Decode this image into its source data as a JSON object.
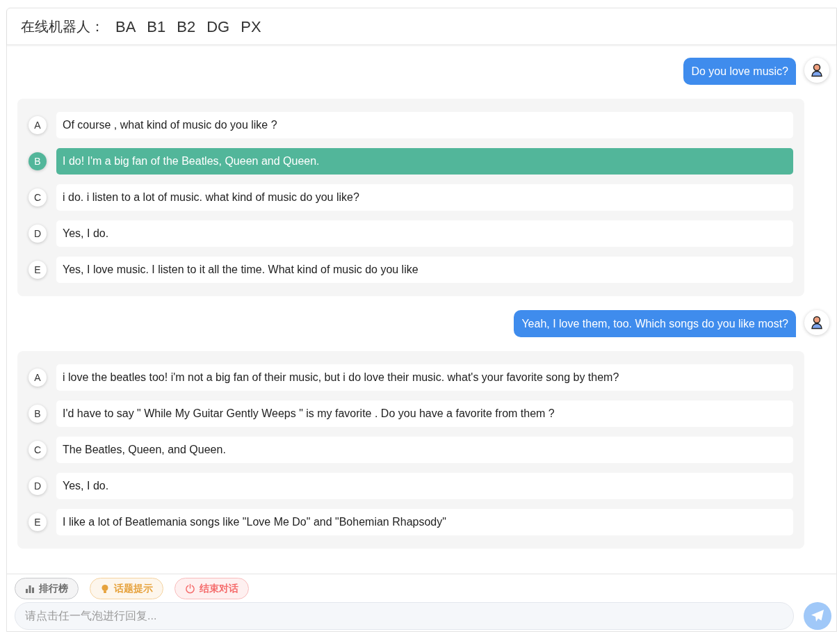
{
  "header": {
    "label": "在线机器人：",
    "bots": [
      "BA",
      "B1",
      "B2",
      "DG",
      "PX"
    ]
  },
  "turns": [
    {
      "user": "Do you love music?",
      "options": [
        {
          "letter": "A",
          "text": "Of course , what kind of music do you like ?",
          "selected": false
        },
        {
          "letter": "B",
          "text": "I do! I'm a big fan of the Beatles, Queen and Queen.",
          "selected": true
        },
        {
          "letter": "C",
          "text": "i do. i listen to a lot of music. what kind of music do you like?",
          "selected": false
        },
        {
          "letter": "D",
          "text": "Yes, I do.",
          "selected": false
        },
        {
          "letter": "E",
          "text": "Yes, I love music. I listen to it all the time. What kind of music do you like",
          "selected": false
        }
      ]
    },
    {
      "user": "Yeah, I love them, too. Which songs do you like most?",
      "options": [
        {
          "letter": "A",
          "text": "i love the beatles too! i'm not a big fan of their music, but i do love their music. what's your favorite song by them?",
          "selected": false
        },
        {
          "letter": "B",
          "text": "I'd have to say \" While My Guitar Gently Weeps \" is my favorite . Do you have a favorite from them ?",
          "selected": false
        },
        {
          "letter": "C",
          "text": "The Beatles, Queen, and Queen.",
          "selected": false
        },
        {
          "letter": "D",
          "text": "Yes, I do.",
          "selected": false
        },
        {
          "letter": "E",
          "text": "I like a lot of Beatlemania songs like \"Love Me Do\" and \"Bohemian Rhapsody\"",
          "selected": false
        }
      ]
    }
  ],
  "toolbar": [
    {
      "kind": "ranking",
      "label": "排行榜"
    },
    {
      "kind": "hint",
      "label": "话题提示"
    },
    {
      "kind": "end",
      "label": "结束对话"
    }
  ],
  "input": {
    "placeholder": "请点击任一气泡进行回复..."
  }
}
